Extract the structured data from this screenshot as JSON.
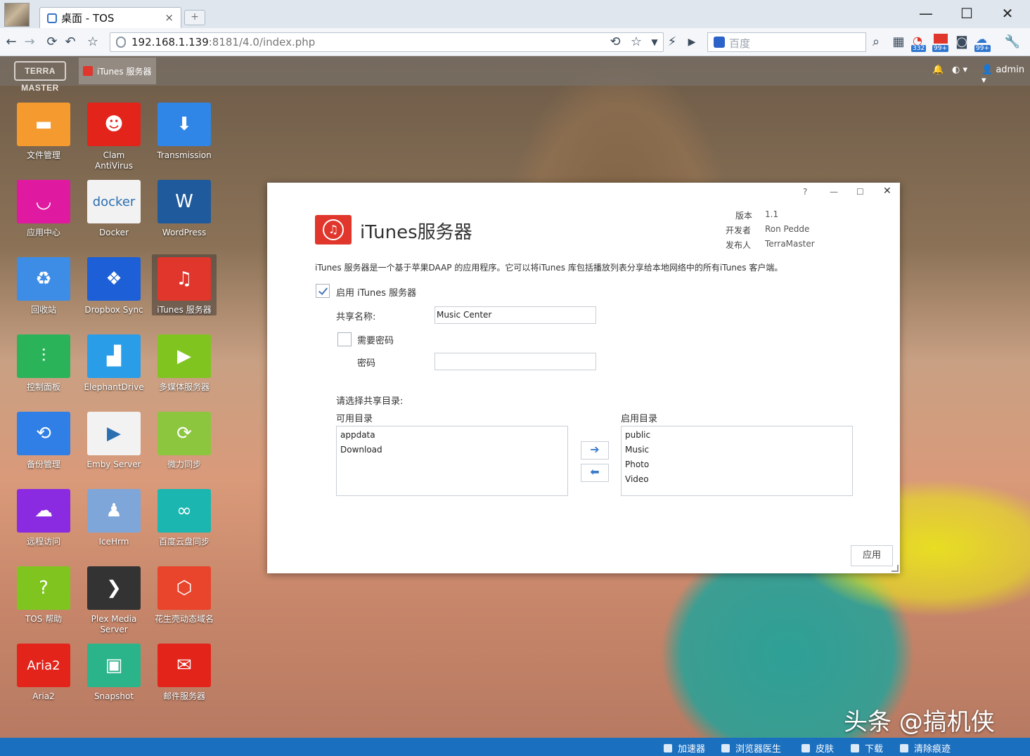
{
  "browser": {
    "tab_title": "桌面 - TOS",
    "tab_close": "×",
    "new_tab": "+",
    "window_controls": {
      "minimize": "—",
      "maximize": "☐",
      "close": "✕"
    },
    "url_host": "192.168.1.139",
    "url_rest": ":8181/4.0/index.php",
    "search_placeholder": "百度",
    "ext_badges": [
      "332",
      "99+",
      "99+"
    ]
  },
  "tos": {
    "taskbar_item": "iTunes 服务器",
    "user": "admin",
    "logo_text": "TERRA MASTER"
  },
  "desktop_icons": [
    {
      "label": "文件管理",
      "color": "#f59a2e",
      "glyph": "▬"
    },
    {
      "label": "Clam AntiVirus",
      "color": "#e3241b",
      "glyph": "☻"
    },
    {
      "label": "Transmission",
      "color": "#2f86e6",
      "glyph": "⬇"
    },
    {
      "label": "应用中心",
      "color": "#e01aa0",
      "glyph": "◡"
    },
    {
      "label": "Docker",
      "color": "#f2f2f2",
      "glyph": "docker"
    },
    {
      "label": "WordPress",
      "color": "#1e5a9c",
      "glyph": "W"
    },
    {
      "label": "回收站",
      "color": "#3d8ce6",
      "glyph": "♻"
    },
    {
      "label": "Dropbox Sync",
      "color": "#1c5fd6",
      "glyph": "❖"
    },
    {
      "label": "iTunes 服务器",
      "color": "#e0362b",
      "glyph": "♫"
    },
    {
      "label": "控制面板",
      "color": "#2bb35a",
      "glyph": "⫶"
    },
    {
      "label": "ElephantDrive",
      "color": "#2a9de8",
      "glyph": "▟"
    },
    {
      "label": "多媒体服务器",
      "color": "#7fc41f",
      "glyph": "▶"
    },
    {
      "label": "备份管理",
      "color": "#2f7fe6",
      "glyph": "⟲"
    },
    {
      "label": "Emby Server",
      "color": "#f2f2f2",
      "glyph": "▶"
    },
    {
      "label": "微力同步",
      "color": "#8cc63f",
      "glyph": "⟳"
    },
    {
      "label": "远程访问",
      "color": "#8a2be2",
      "glyph": "☁"
    },
    {
      "label": "IceHrm",
      "color": "#7fa6d8",
      "glyph": "♟"
    },
    {
      "label": "百度云盘同步",
      "color": "#1bb6b0",
      "glyph": "∞"
    },
    {
      "label": "TOS 帮助",
      "color": "#7fc41f",
      "glyph": "?"
    },
    {
      "label": "Plex Media Server",
      "color": "#333333",
      "glyph": "❯"
    },
    {
      "label": "花生壳动态域名",
      "color": "#e8452c",
      "glyph": "⬡"
    },
    {
      "label": "Aria2",
      "color": "#e3241b",
      "glyph": "Aria2"
    },
    {
      "label": "Snapshot",
      "color": "#2bb38a",
      "glyph": "▣"
    },
    {
      "label": "邮件服务器",
      "color": "#e3241b",
      "glyph": "✉"
    }
  ],
  "app": {
    "title": "iTunes服务器",
    "version_label": "版本",
    "version": "1.1",
    "developer_label": "开发者",
    "developer": "Ron Pedde",
    "publisher_label": "发布人",
    "publisher": "TerraMaster",
    "description": "iTunes 服务器是一个基于苹果DAAP 的应用程序。它可以将iTunes 库包括播放列表分享给本地网络中的所有iTunes 客户端。",
    "enable_label": "启用 iTunes 服务器",
    "share_name_label": "共享名称:",
    "share_name_value": "Music Center",
    "require_password_label": "需要密码",
    "password_label": "密码",
    "password_value": "",
    "select_dirs_label": "请选择共享目录:",
    "available_label": "可用目录",
    "enabled_label": "启用目录",
    "available_dirs": [
      "appdata",
      "Download"
    ],
    "enabled_dirs": [
      "public",
      "Music",
      "Photo",
      "Video"
    ],
    "apply_label": "应用",
    "win_controls": {
      "help": "?",
      "minimize": "—",
      "maximize": "☐",
      "close": "✕"
    }
  },
  "statusbar": {
    "items": [
      "加速器",
      "浏览器医生",
      "皮肤",
      "下载",
      "清除痕迹"
    ]
  },
  "watermark": "头条 @搞机侠"
}
